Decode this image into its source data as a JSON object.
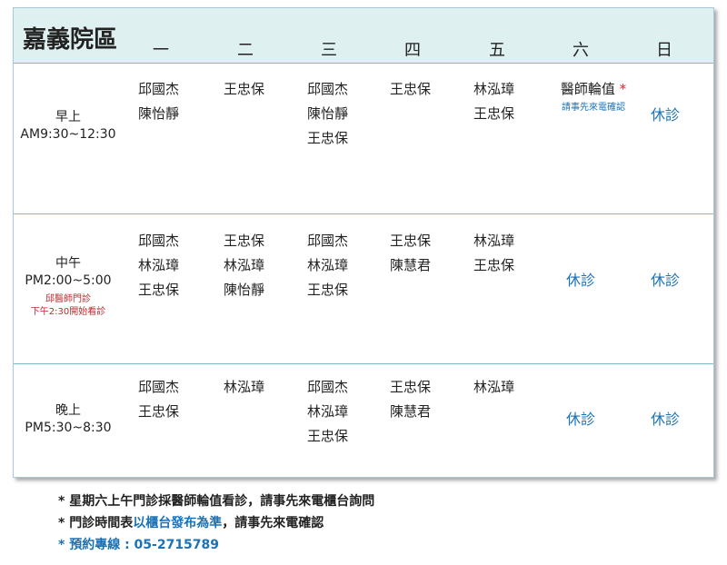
{
  "header": {
    "title": "嘉義院區",
    "days": [
      "一",
      "二",
      "三",
      "四",
      "五",
      "六",
      "日"
    ]
  },
  "rows": [
    {
      "slot": {
        "name": "早上",
        "time": "AM9:30~12:30",
        "note": ""
      },
      "cells": [
        [
          "邱國杰",
          "陳怡靜"
        ],
        [
          "王忠保"
        ],
        [
          "邱國杰",
          "陳怡靜",
          "王忠保"
        ],
        [
          "王忠保"
        ],
        [
          "林泓璋",
          "王忠保"
        ],
        {
          "text": "醫師輪值",
          "star": "*",
          "sub": "請事先來電確認"
        },
        {
          "closed": "休診"
        }
      ]
    },
    {
      "slot": {
        "name": "中午",
        "time": "PM2:00~5:00",
        "note": "邱醫師門診\n下午2:30開始看診"
      },
      "cells": [
        [
          "邱國杰",
          "林泓璋",
          "王忠保"
        ],
        [
          "王忠保",
          "林泓璋",
          "陳怡靜"
        ],
        [
          "邱國杰",
          "林泓璋",
          "王忠保"
        ],
        [
          "王忠保",
          "陳慧君"
        ],
        [
          "林泓璋",
          "王忠保"
        ],
        {
          "closed": "休診"
        },
        {
          "closed": "休診"
        }
      ]
    },
    {
      "slot": {
        "name": "晚上",
        "time": "PM5:30~8:30",
        "note": ""
      },
      "cells": [
        [
          "邱國杰",
          "王忠保"
        ],
        [
          "林泓璋"
        ],
        [
          "邱國杰",
          "林泓璋",
          "王忠保"
        ],
        [
          "王忠保",
          "陳慧君"
        ],
        [
          "林泓璋"
        ],
        {
          "closed": "休診"
        },
        {
          "closed": "休診"
        }
      ]
    }
  ],
  "notes": {
    "line1": "* 星期六上午門診採醫師輪值看診，請事先來電櫃台詢問",
    "line2_prefix": "* 門診時間表",
    "line2_highlight": "以櫃台發布為準",
    "line2_suffix": "，請事先來電確認",
    "line3": "* 預約專線 : 05-2715789"
  }
}
